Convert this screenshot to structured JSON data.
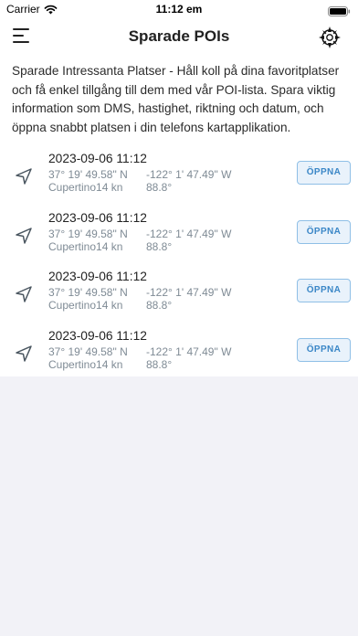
{
  "status_bar": {
    "carrier": "Carrier",
    "time": "11:12 em"
  },
  "header": {
    "title": "Sparade POIs"
  },
  "description": "Sparade Intressanta Platser - Håll koll på dina favoritplatser och få enkel tillgång till dem med vår POI-lista. Spara viktig information som DMS, hastighet, riktning och datum, och öppna snabbt platsen i din telefons kartapplikation.",
  "pois": [
    {
      "date": "2023-09-06 11:12",
      "lat": "37° 19' 49.58\" N",
      "lon": "-122° 1' 47.49\" W",
      "speed": "Cupertino14 kn",
      "alt": "88.8°",
      "button": "ÖPPNA"
    },
    {
      "date": "2023-09-06 11:12",
      "lat": "37° 19' 49.58\" N",
      "lon": "-122° 1' 47.49\" W",
      "speed": "Cupertino14 kn",
      "alt": "88.8°",
      "button": "ÖPPNA"
    },
    {
      "date": "2023-09-06 11:12",
      "lat": "37° 19' 49.58\" N",
      "lon": "-122° 1' 47.49\" W",
      "speed": "Cupertino14 kn",
      "alt": "88.8°",
      "button": "ÖPPNA"
    },
    {
      "date": "2023-09-06 11:12",
      "lat": "37° 19' 49.58\" N",
      "lon": "-122° 1' 47.49\" W",
      "speed": "Cupertino14 kn",
      "alt": "88.8°",
      "button": "ÖPPNA"
    }
  ],
  "icons": {
    "menu": "hamburger-menu-icon",
    "compass": "compass-icon",
    "location": "location-arrow-icon",
    "wifi": "wifi-icon",
    "battery": "battery-icon"
  },
  "colors": {
    "accent": "#3b87c7",
    "button_bg": "#e9f2fb",
    "secondary_text": "#7f8b95",
    "background": "#f2f2f7"
  }
}
